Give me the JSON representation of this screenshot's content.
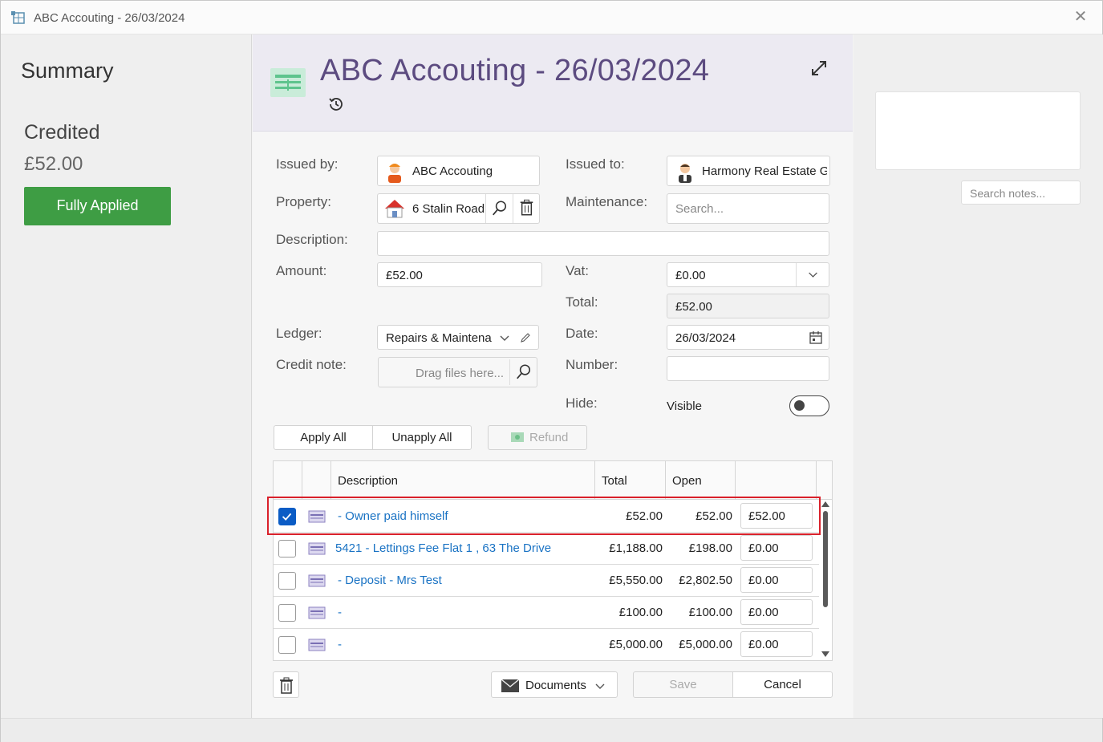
{
  "window": {
    "title": "ABC Accouting - 26/03/2024",
    "close_glyph": "✕"
  },
  "summary": {
    "heading": "Summary",
    "status": "Credited",
    "amount": "£52.00",
    "badge": "Fully Applied",
    "badge_color": "#3e9d44"
  },
  "header": {
    "title": "ABC Accouting - 26/03/2024",
    "title_color": "#5c4b80"
  },
  "form": {
    "issued_by_label": "Issued by:",
    "issued_by_value": "ABC Accouting",
    "issued_to_label": "Issued to:",
    "issued_to_value": "Harmony Real Estate G",
    "property_label": "Property:",
    "property_value": "6 Stalin Road",
    "maintenance_label": "Maintenance:",
    "maintenance_placeholder": "Search...",
    "description_label": "Description:",
    "description_value": "",
    "amount_label": "Amount:",
    "amount_value": "£52.00",
    "vat_label": "Vat:",
    "vat_value": "£0.00",
    "total_label": "Total:",
    "total_value": "£52.00",
    "ledger_label": "Ledger:",
    "ledger_value": "Repairs & Maintena",
    "date_label": "Date:",
    "date_value": "26/03/2024",
    "credit_note_label": "Credit note:",
    "credit_note_placeholder": "Drag files here...",
    "number_label": "Number:",
    "number_value": "",
    "hide_label": "Hide:",
    "hide_value": "Visible"
  },
  "actions": {
    "apply_all": "Apply All",
    "unapply_all": "Unapply All",
    "refund": "Refund"
  },
  "grid": {
    "headers": {
      "description": "Description",
      "total": "Total",
      "open": "Open"
    },
    "rows": [
      {
        "checked": true,
        "description": " - Owner paid himself",
        "total": "£52.00",
        "open": "£52.00",
        "apply": "£52.00"
      },
      {
        "checked": false,
        "description": "5421 - Lettings Fee Flat 1 , 63 The Drive",
        "total": "£1,188.00",
        "open": "£198.00",
        "apply": "£0.00"
      },
      {
        "checked": false,
        "description": " - Deposit - Mrs Test",
        "total": "£5,550.00",
        "open": "£2,802.50",
        "apply": "£0.00"
      },
      {
        "checked": false,
        "description": " -",
        "total": "£100.00",
        "open": "£100.00",
        "apply": "£0.00"
      },
      {
        "checked": false,
        "description": " -",
        "total": "£5,000.00",
        "open": "£5,000.00",
        "apply": "£0.00"
      }
    ]
  },
  "footer": {
    "documents": "Documents",
    "save": "Save",
    "cancel": "Cancel"
  },
  "notes": {
    "search_placeholder": "Search notes..."
  }
}
